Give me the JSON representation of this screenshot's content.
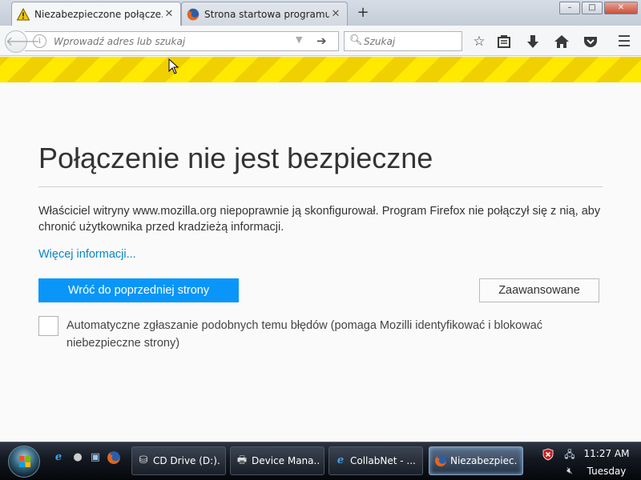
{
  "colors": {
    "accent": "#0996f8",
    "link": "#0a84c6",
    "stripe": "#ffe900"
  },
  "tabs": [
    {
      "title": "Niezabezpieczone połącze...",
      "icon": "warning-icon",
      "active": true
    },
    {
      "title": "Strona startowa programu ...",
      "icon": "firefox-icon",
      "active": false
    }
  ],
  "window": {
    "minimize": "–",
    "maximize": "□",
    "close": "✕"
  },
  "urlbar": {
    "placeholder": "Wprowadź adres lub szukaj"
  },
  "search": {
    "placeholder": "Szukaj"
  },
  "error": {
    "title": "Połączenie nie jest bezpieczne",
    "description": "Właściciel witryny www.mozilla.org niepoprawnie ją skonfigurował. Program Firefox nie połączył się z nią, aby chronić użytkownika przed kradzieżą informacji.",
    "more_link": "Więcej informacji...",
    "back_button": "Wróć do poprzedniej strony",
    "advanced_button": "Zaawansowane",
    "report_checkbox_label": "Automatyczne zgłaszanie podobnych temu błędów (pomaga Mozilli identyfikować i blokować niebezpieczne strony)",
    "report_checked": false
  },
  "taskbar": {
    "tasks": [
      {
        "label": "CD Drive (D:)...",
        "icon": "drive-icon"
      },
      {
        "label": "Device Mana...",
        "icon": "device-manager-icon"
      },
      {
        "label": "CollabNet - ...",
        "icon": "ie-icon"
      },
      {
        "label": "Niezabezpiec...",
        "icon": "firefox-icon",
        "active": true
      }
    ],
    "time": "11:27 AM",
    "day": "Tuesday"
  }
}
